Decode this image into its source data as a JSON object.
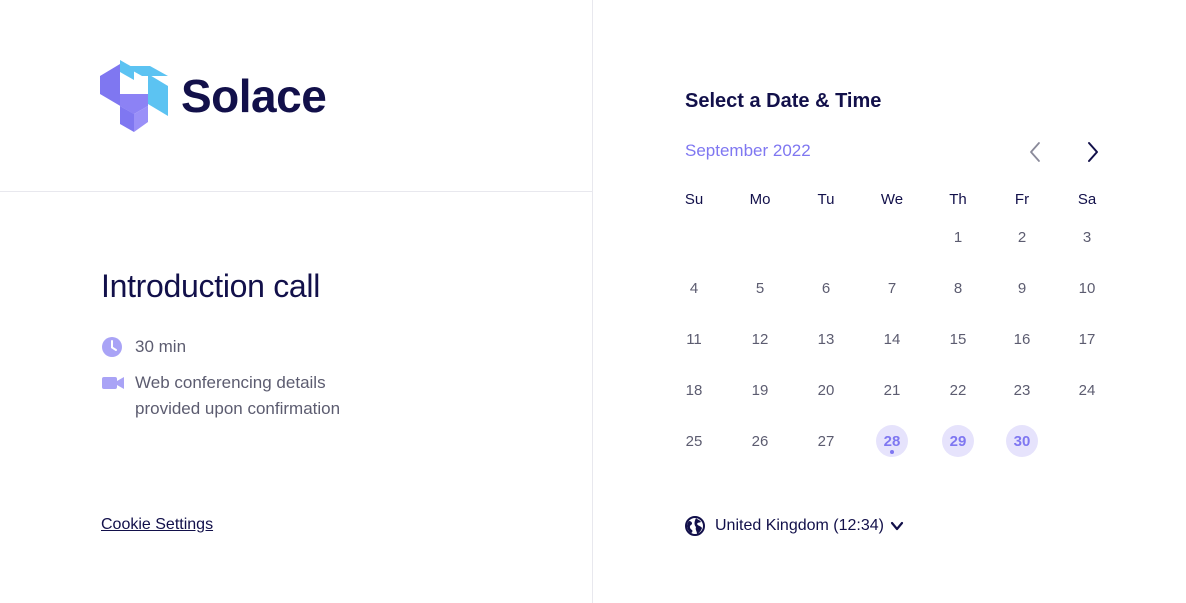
{
  "brand": {
    "name": "Solace",
    "accent": "#7f77f1",
    "logo_colors": [
      "#5cc3f2",
      "#8c82f5"
    ]
  },
  "event": {
    "title": "Introduction call",
    "duration": "30 min",
    "duration_icon": "clock-icon",
    "conferencing": "Web conferencing details provided upon confirmation",
    "conferencing_icon": "video-camera-icon"
  },
  "footer": {
    "cookie_label": "Cookie Settings"
  },
  "calendar": {
    "title": "Select a Date & Time",
    "month_label": "September 2022",
    "prev_icon": "chevron-left-icon",
    "next_icon": "chevron-right-icon",
    "weekdays": [
      "Su",
      "Mo",
      "Tu",
      "We",
      "Th",
      "Fr",
      "Sa"
    ],
    "first_weekday_index": 4,
    "days_in_month": 30,
    "available_days": [
      28,
      29,
      30
    ],
    "today": 28
  },
  "timezone": {
    "label": "United Kingdom (12:34)",
    "icon": "globe-icon",
    "dropdown_icon": "chevron-down-icon"
  }
}
